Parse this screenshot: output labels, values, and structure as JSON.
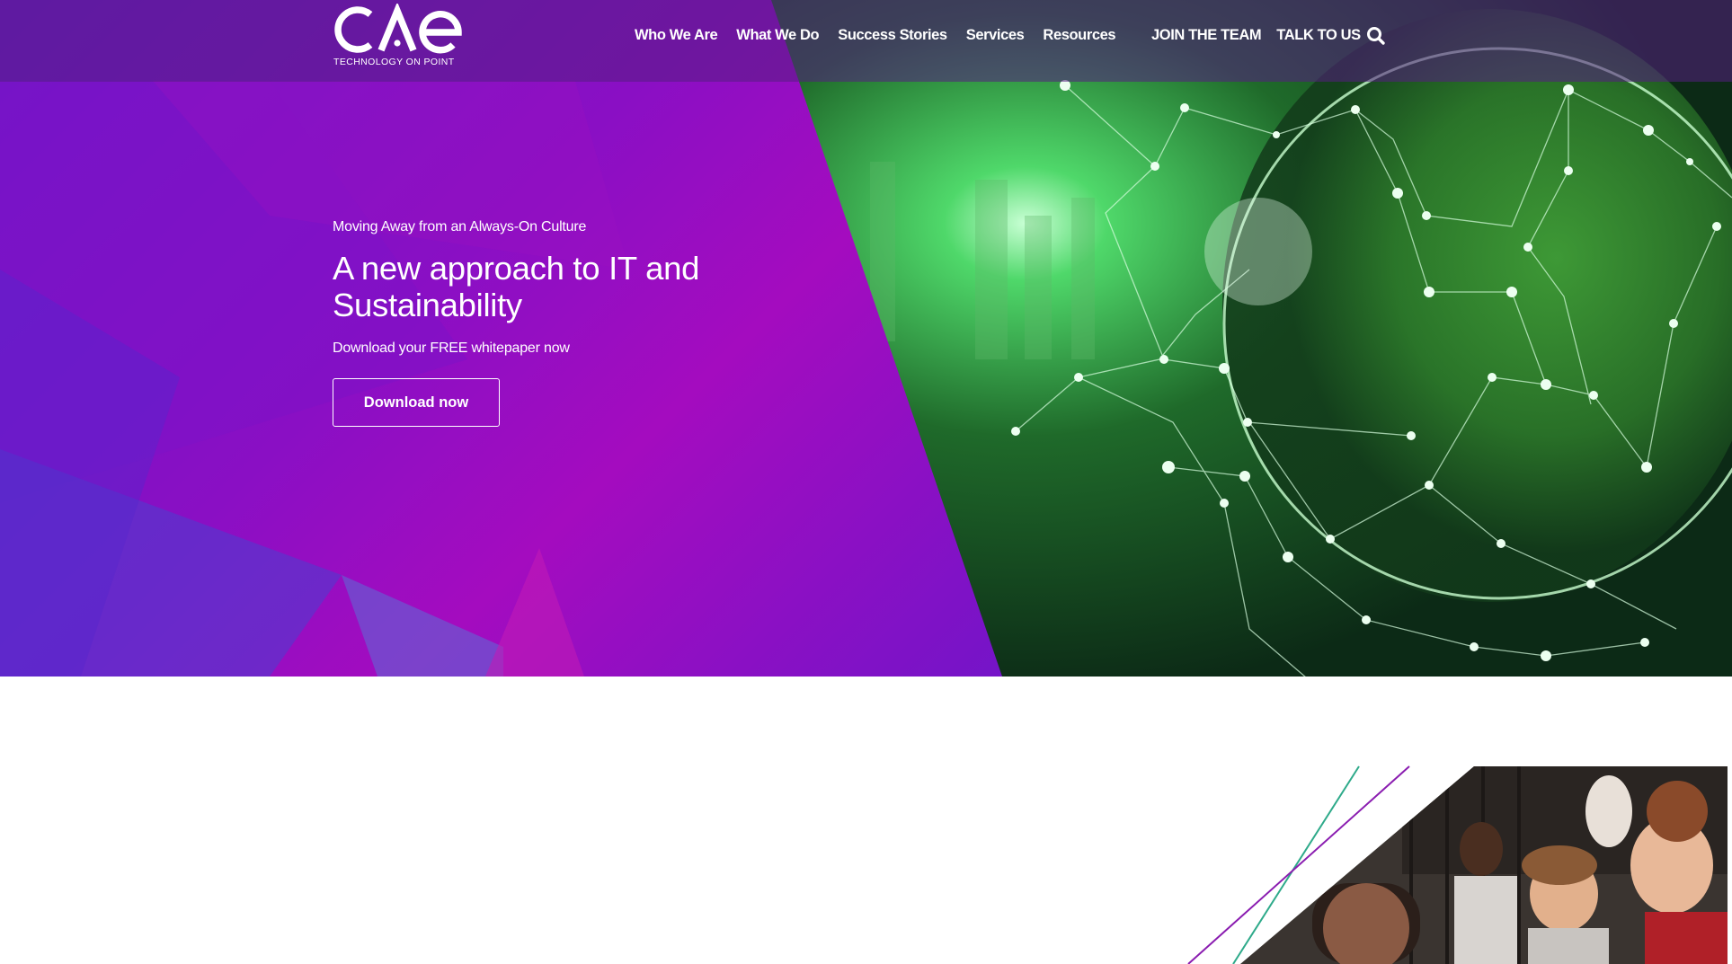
{
  "brand": {
    "logo_text": "CAE",
    "tagline": "TECHNOLOGY ON POINT"
  },
  "nav": {
    "items": [
      {
        "label": "Who We Are"
      },
      {
        "label": "What We Do"
      },
      {
        "label": "Success Stories"
      },
      {
        "label": "Services"
      },
      {
        "label": "Resources"
      }
    ],
    "join_label": "JOIN THE TEAM",
    "talk_label": "TALK TO US",
    "search_icon": "search-icon"
  },
  "hero": {
    "eyebrow": "Moving Away from an Always-On Culture",
    "headline": "A new approach to IT and Sustainability",
    "subtext": "Download your FREE whitepaper now",
    "cta_label": "Download now",
    "image": "green-forest-network-globe"
  },
  "section_two": {
    "image": "team-working-photo"
  },
  "colors": {
    "purple": "#8a0fc4",
    "violet": "#5a1ccd",
    "green": "#2e8b2e",
    "white": "#ffffff"
  }
}
